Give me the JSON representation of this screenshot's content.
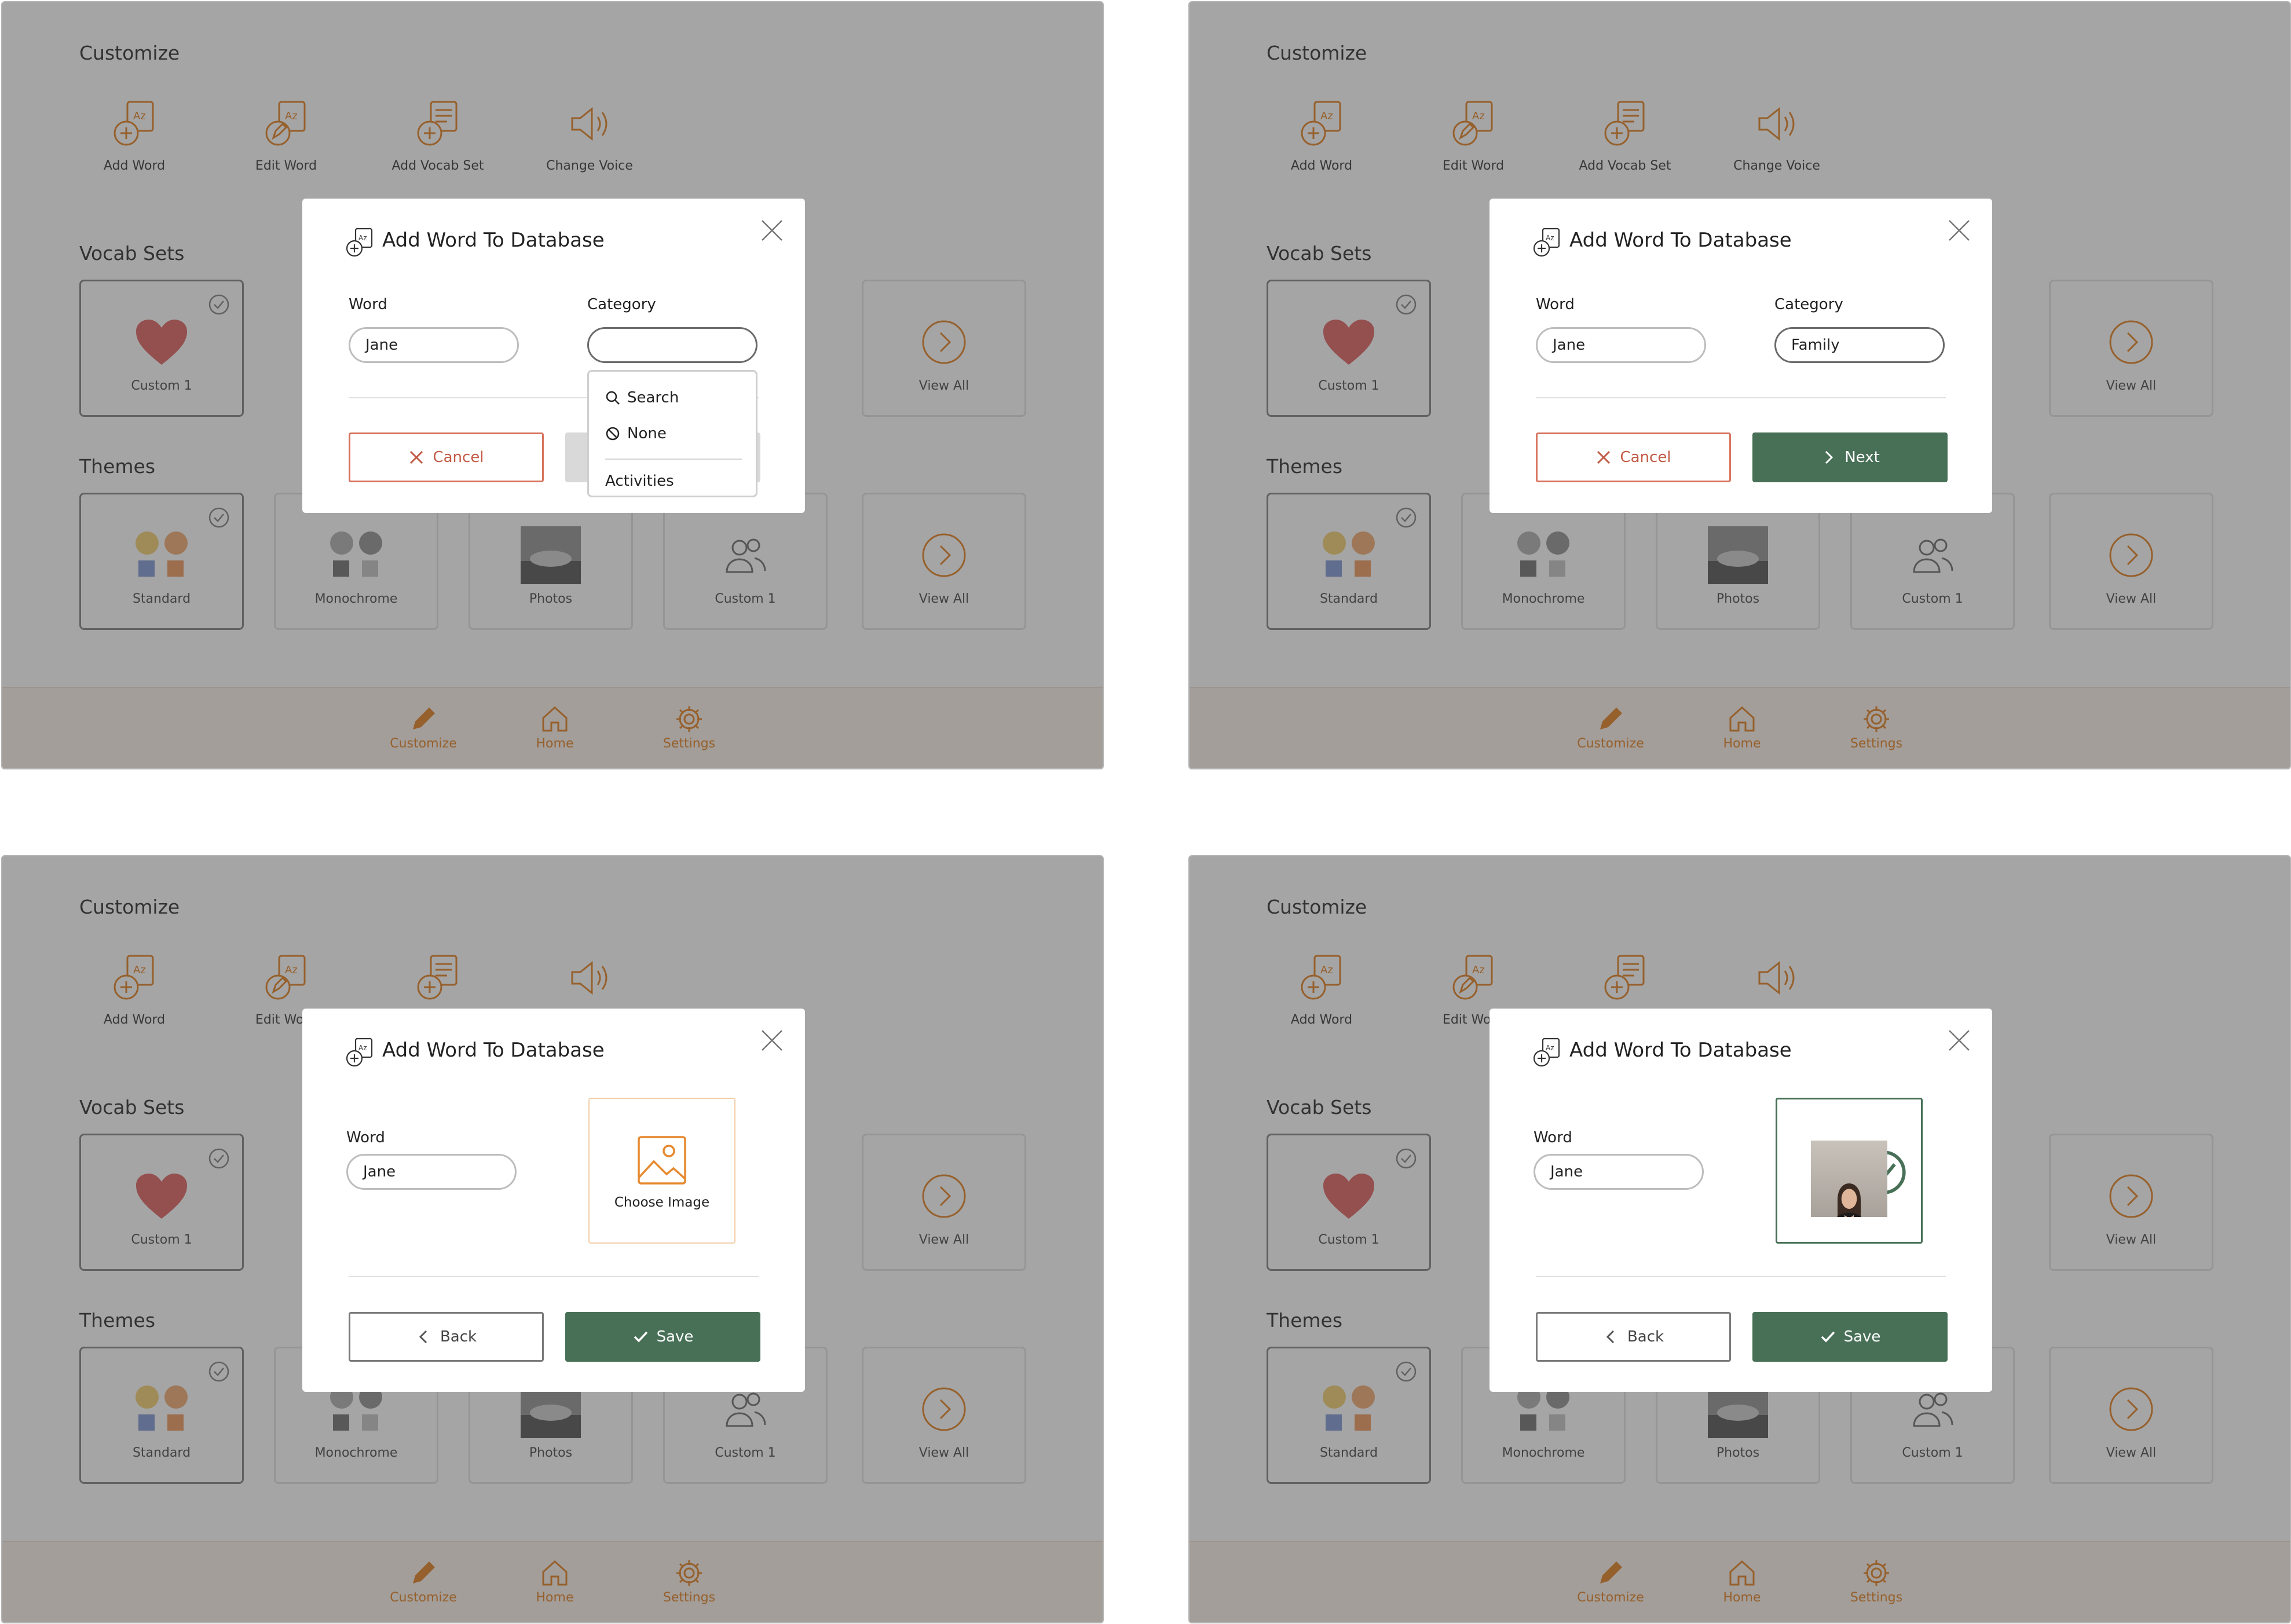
{
  "background": {
    "customize_title": "Customize",
    "customize_items": [
      {
        "label": "Add Word",
        "icon": "add-word-icon"
      },
      {
        "label": "Edit Word",
        "icon": "edit-word-icon"
      },
      {
        "label": "Add Vocab Set",
        "icon": "add-vocab-set-icon"
      },
      {
        "label": "Change Voice",
        "icon": "speaker-icon"
      }
    ],
    "vocab_sets_title": "Vocab Sets",
    "vocab_tiles": [
      {
        "label": "Custom 1",
        "icon": "heart-icon",
        "selected": true
      },
      {
        "label": "View All",
        "icon": "chevron-right-circle-icon"
      }
    ],
    "themes_title": "Themes",
    "theme_tiles": [
      {
        "label": "Standard",
        "selected": true
      },
      {
        "label": "Monochrome"
      },
      {
        "label": "Photos"
      },
      {
        "label": "Custom 1"
      },
      {
        "label": "View All"
      }
    ],
    "nav": [
      {
        "label": "Customize",
        "icon": "pencil-icon",
        "active": true
      },
      {
        "label": "Home",
        "icon": "home-icon"
      },
      {
        "label": "Settings",
        "icon": "gear-icon"
      }
    ]
  },
  "colors": {
    "accent": "#e6892f",
    "primary": "#477057",
    "danger": "#c25a45",
    "overlay": "#282828"
  },
  "modal": {
    "title": "Add Word To Database",
    "word_label": "Word",
    "category_label": "Category",
    "word_value": "Jane",
    "category_value": "Family",
    "cancel_label": "Cancel",
    "next_label": "Next",
    "back_label": "Back",
    "save_label": "Save",
    "choose_image_label": "Choose Image",
    "dropdown": {
      "search_label": "Search",
      "none_label": "None",
      "first_option": "Activities"
    }
  }
}
